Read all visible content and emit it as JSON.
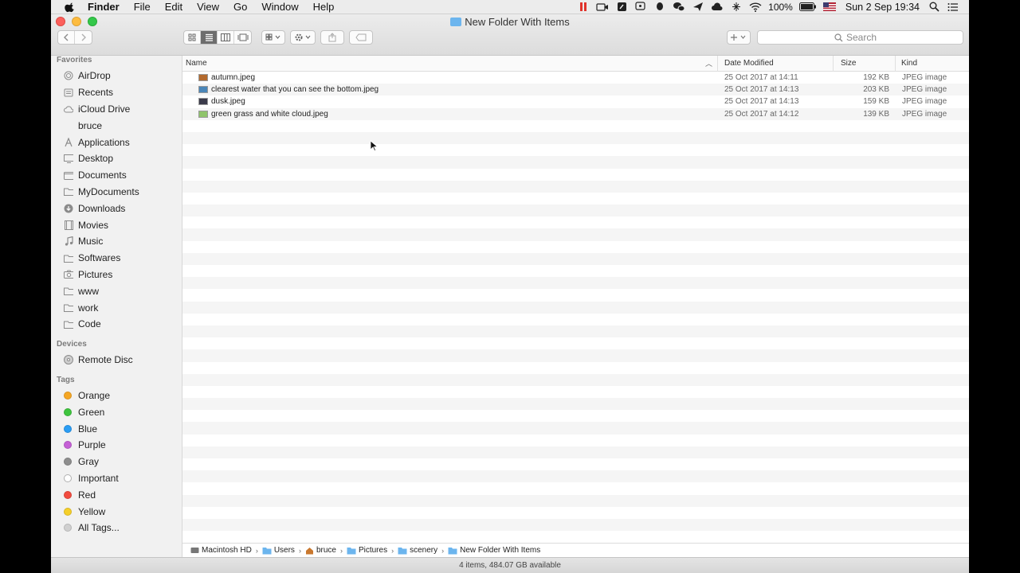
{
  "menubar": {
    "app_name": "Finder",
    "items": [
      "File",
      "Edit",
      "View",
      "Go",
      "Window",
      "Help"
    ],
    "battery": "100%",
    "datetime": "Sun 2 Sep  19:34"
  },
  "window": {
    "title": "New Folder With Items"
  },
  "search": {
    "placeholder": "Search"
  },
  "sidebar": {
    "favorites_header": "Favorites",
    "favorites": [
      {
        "label": "AirDrop",
        "icon": "airdrop-icon"
      },
      {
        "label": "Recents",
        "icon": "recents-icon"
      },
      {
        "label": "iCloud Drive",
        "icon": "cloud-icon"
      },
      {
        "label": "bruce",
        "icon": "home-icon"
      },
      {
        "label": "Applications",
        "icon": "applications-icon"
      },
      {
        "label": "Desktop",
        "icon": "desktop-icon"
      },
      {
        "label": "Documents",
        "icon": "documents-icon"
      },
      {
        "label": "MyDocuments",
        "icon": "folder-icon"
      },
      {
        "label": "Downloads",
        "icon": "downloads-icon"
      },
      {
        "label": "Movies",
        "icon": "movies-icon"
      },
      {
        "label": "Music",
        "icon": "music-icon"
      },
      {
        "label": "Softwares",
        "icon": "folder-icon"
      },
      {
        "label": "Pictures",
        "icon": "camera-icon"
      },
      {
        "label": "www",
        "icon": "folder-icon"
      },
      {
        "label": "work",
        "icon": "folder-icon"
      },
      {
        "label": "Code",
        "icon": "folder-icon"
      }
    ],
    "devices_header": "Devices",
    "devices": [
      {
        "label": "Remote Disc",
        "icon": "disc-icon"
      }
    ],
    "tags_header": "Tags",
    "tags": [
      {
        "label": "Orange",
        "color": "#f5a623"
      },
      {
        "label": "Green",
        "color": "#3ec43e"
      },
      {
        "label": "Blue",
        "color": "#2a9df4"
      },
      {
        "label": "Purple",
        "color": "#c560d6"
      },
      {
        "label": "Gray",
        "color": "#8e8e8e"
      },
      {
        "label": "Important",
        "color": "#ffffff"
      },
      {
        "label": "Red",
        "color": "#f24b3f"
      },
      {
        "label": "Yellow",
        "color": "#f5cf2a"
      },
      {
        "label": "All Tags...",
        "color": "#d0d0d0"
      }
    ]
  },
  "columns": {
    "name": "Name",
    "date": "Date Modified",
    "size": "Size",
    "kind": "Kind"
  },
  "files": [
    {
      "name": "autumn.jpeg",
      "date": "25 Oct 2017 at 14:11",
      "size": "192 KB",
      "kind": "JPEG image",
      "thumb": "#b36a2e"
    },
    {
      "name": "clearest water that you can see the bottom.jpeg",
      "date": "25 Oct 2017 at 14:13",
      "size": "203 KB",
      "kind": "JPEG image",
      "thumb": "#4a86b8"
    },
    {
      "name": "dusk.jpeg",
      "date": "25 Oct 2017 at 14:13",
      "size": "159 KB",
      "kind": "JPEG image",
      "thumb": "#3a3a4a"
    },
    {
      "name": "green grass and white cloud.jpeg",
      "date": "25 Oct 2017 at 14:12",
      "size": "139 KB",
      "kind": "JPEG image",
      "thumb": "#8fc46a"
    }
  ],
  "pathbar": [
    "Macintosh HD",
    "Users",
    "bruce",
    "Pictures",
    "scenery",
    "New Folder With Items"
  ],
  "status": "4 items, 484.07 GB available"
}
